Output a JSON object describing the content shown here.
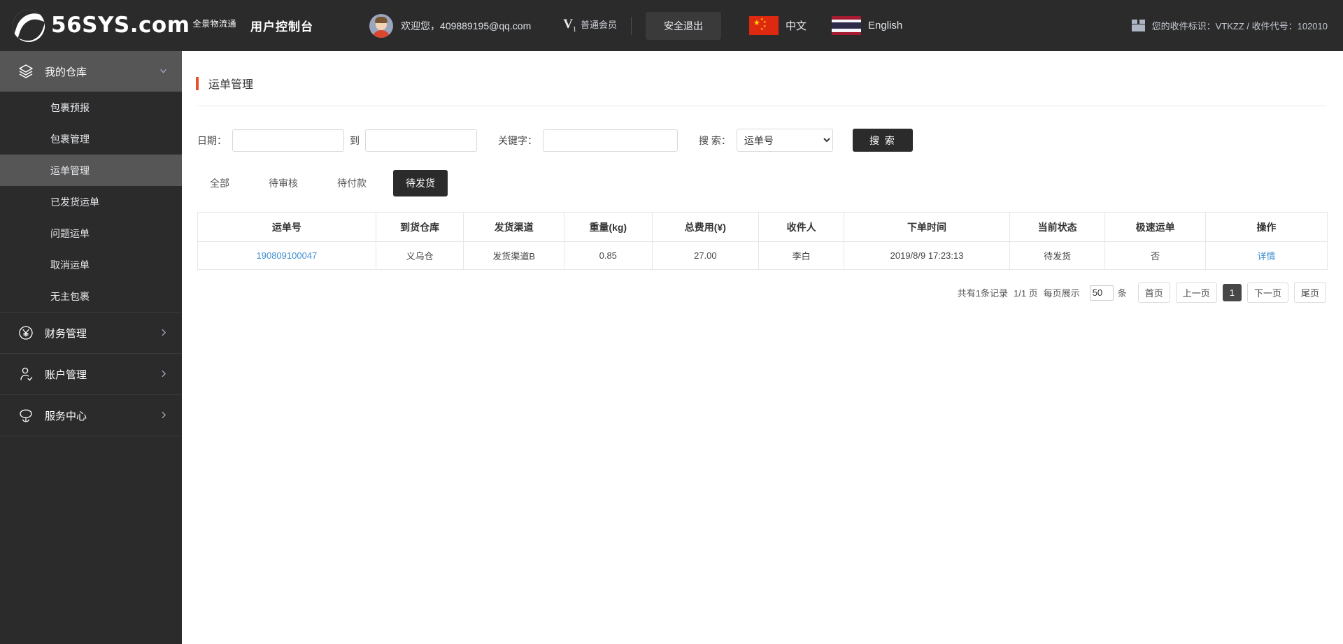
{
  "topbar": {
    "logo_name": "56SYS",
    "logo_suffix": ".com",
    "logo_cn": "全景物流通",
    "console_title": "用户控制台",
    "welcome_text": "欢迎您，409889195@qq.com",
    "level_mark": "V",
    "level_sub": "1",
    "level_name": "普通会员",
    "logout_label": "安全退出",
    "lang_cn": "中文",
    "lang_en": "English",
    "receiver_info": "您的收件标识：VTKZZ / 收件代号：102010"
  },
  "sidebar": {
    "groups": [
      {
        "label": "我的仓库",
        "icon": "layers-icon",
        "active": true,
        "items": [
          {
            "label": "包裹预报",
            "active": false
          },
          {
            "label": "包裹管理",
            "active": false
          },
          {
            "label": "运单管理",
            "active": true
          },
          {
            "label": "已发货运单",
            "active": false
          },
          {
            "label": "问题运单",
            "active": false
          },
          {
            "label": "取消运单",
            "active": false
          },
          {
            "label": "无主包裹",
            "active": false
          }
        ]
      },
      {
        "label": "财务管理",
        "icon": "yuan-circle-icon",
        "active": false,
        "items": []
      },
      {
        "label": "账户管理",
        "icon": "user-icon",
        "active": false,
        "items": []
      },
      {
        "label": "服务中心",
        "icon": "support-icon",
        "active": false,
        "items": []
      }
    ]
  },
  "page": {
    "title": "运单管理"
  },
  "filters": {
    "date_label": "日期：",
    "date_from_value": "",
    "date_to_joiner": "到",
    "date_to_value": "",
    "keyword_label": "关键字：",
    "keyword_value": "",
    "search_field_label": "搜 索：",
    "search_field_value": "运单号",
    "search_field_options": [
      "运单号"
    ],
    "search_button_label": "搜 索"
  },
  "tabs": [
    {
      "label": "全部",
      "active": false
    },
    {
      "label": "待审核",
      "active": false
    },
    {
      "label": "待付款",
      "active": false
    },
    {
      "label": "待发货",
      "active": true
    }
  ],
  "table": {
    "columns": [
      "运单号",
      "到货仓库",
      "发货渠道",
      "重量(kg)",
      "总费用(¥)",
      "收件人",
      "下单时间",
      "当前状态",
      "极速运单",
      "操作"
    ],
    "rows": [
      {
        "waybill_no": "190809100047",
        "warehouse": "义乌仓",
        "channel": "发货渠道B",
        "weight": "0.85",
        "total_fee": "27.00",
        "recipient": "李白",
        "order_time": "2019/8/9 17:23:13",
        "status": "待发货",
        "express": "否",
        "action": "详情"
      }
    ]
  },
  "pagination": {
    "total_text": "共有1条记录",
    "page_text": "1/1 页",
    "per_page_label": "每页展示",
    "per_page_value": "50",
    "per_page_unit": "条",
    "first_label": "首页",
    "prev_label": "上一页",
    "current_page": "1",
    "next_label": "下一页",
    "last_label": "尾页"
  }
}
